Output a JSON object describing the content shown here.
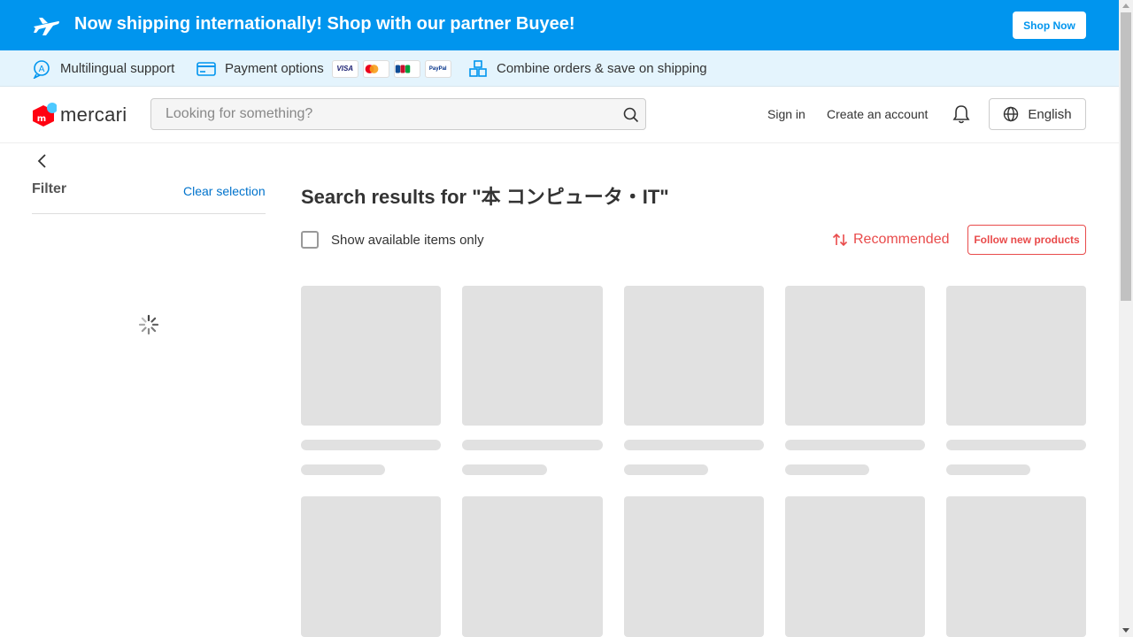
{
  "banner": {
    "text": "Now shipping internationally! Shop with our partner Buyee!",
    "button_label": "Shop Now",
    "icon": "airplane-icon",
    "bg_color": "#0095ee"
  },
  "infobar": {
    "multilingual": "Multilingual support",
    "payment": "Payment options",
    "payment_cards": [
      "VISA",
      "Mastercard",
      "JCB",
      "PayPal"
    ],
    "combine": "Combine orders & save on shipping"
  },
  "header": {
    "logo_text": "mercari",
    "search_placeholder": "Looking for something?",
    "sign_in": "Sign in",
    "create_account": "Create an account",
    "language": "English"
  },
  "sidebar": {
    "filter_title": "Filter",
    "clear_selection": "Clear selection"
  },
  "main": {
    "results_title": "Search results for \"本 コンピュータ・IT\"",
    "available_only_label": "Show available items only",
    "sort_label": "Recommended",
    "follow_label": "Follow new products",
    "accent_color": "#e94b4b"
  }
}
